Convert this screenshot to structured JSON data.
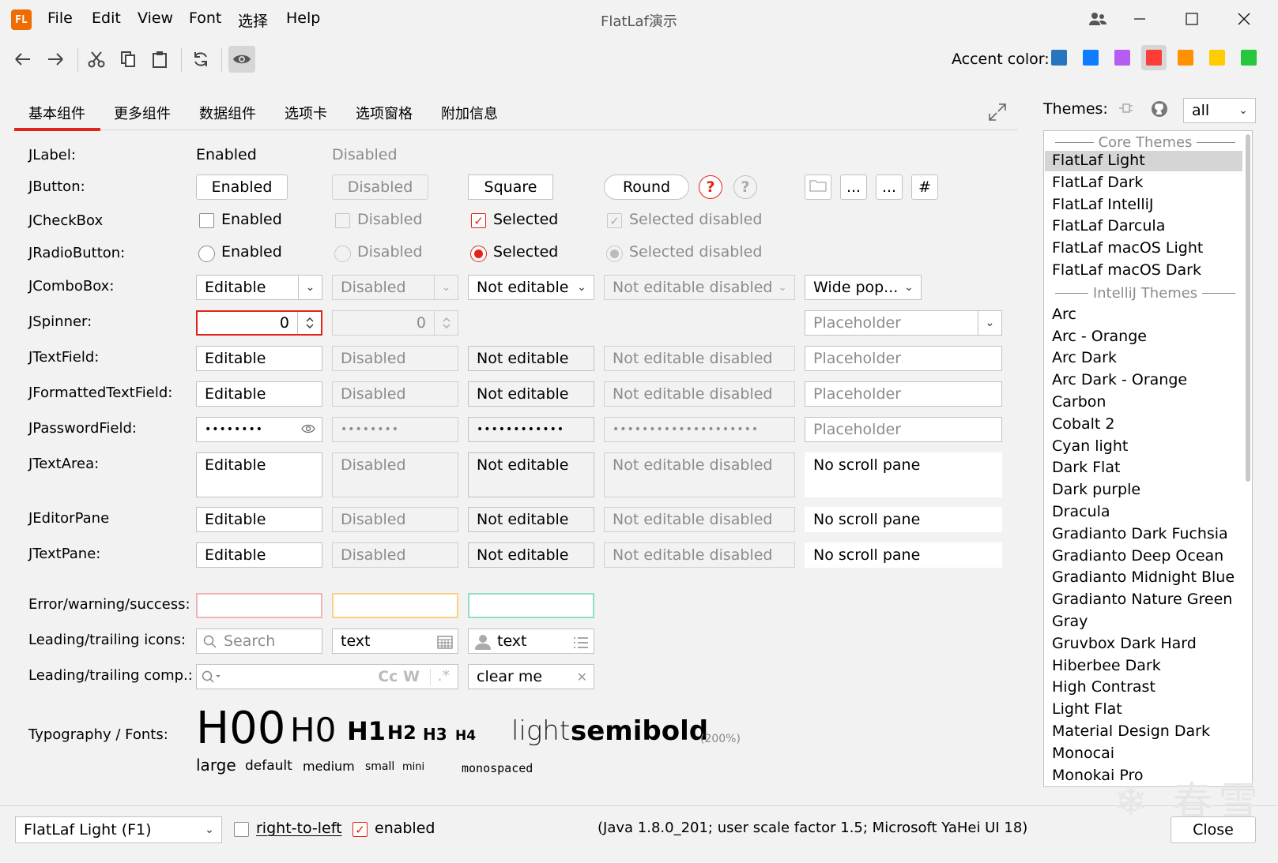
{
  "app": {
    "title": "FlatLaf演示",
    "logo_text": "FL"
  },
  "menus": [
    "File",
    "Edit",
    "View",
    "Font",
    "选择",
    "Help"
  ],
  "accent": {
    "label": "Accent color:",
    "colors": [
      "#2675bf",
      "#0d7cff",
      "#b55df2",
      "#fc3d38",
      "#ff9000",
      "#ffcc00",
      "#25c73c"
    ],
    "selected_index": 3
  },
  "tabs": [
    "基本组件",
    "更多组件",
    "数据组件",
    "选项卡",
    "选项窗格",
    "附加信息"
  ],
  "labels": {
    "jlabel": "JLabel:",
    "jbutton": "JButton:",
    "jcheckbox": "JCheckBox",
    "jradio": "JRadioButton:",
    "jcombo": "JComboBox:",
    "jspinner": "JSpinner:",
    "jtextfield": "JTextField:",
    "jformatted": "JFormattedTextField:",
    "jpassword": "JPasswordField:",
    "jtextarea": "JTextArea:",
    "jeditor": "JEditorPane",
    "jtextpane": "JTextPane:",
    "errors": "Error/warning/success:",
    "icons": "Leading/trailing icons:",
    "comps": "Leading/trailing comp.:",
    "typo": "Typography / Fonts:"
  },
  "values": {
    "enabled": "Enabled",
    "disabled": "Disabled",
    "square": "Square",
    "round": "Round",
    "selected": "Selected",
    "selected_disabled": "Selected disabled",
    "editable": "Editable",
    "not_editable": "Not editable",
    "not_editable_disabled": "Not editable disabled",
    "wide_popup": "Wide pop...",
    "placeholder": "Placeholder",
    "spinner_value": "0",
    "no_scroll": "No scroll pane",
    "search": "Search",
    "text": "text",
    "clear_me": "clear me",
    "dots": "...",
    "hash": "#",
    "help": "?",
    "cc_w": "Cc  W",
    "pw1": "••••••••",
    "pw2": "••••••••",
    "pw3": "••••••••••••",
    "pw4": "••••••••••••••••••••"
  },
  "typography": {
    "h00": "H00",
    "h0": "H0",
    "h1": "H1",
    "h2": "H2",
    "h3": "H3",
    "h4": "H4",
    "light": "light",
    "semibold": "semibold",
    "pct": "(200%)",
    "large": "large",
    "default": "default",
    "medium": "medium",
    "small": "small",
    "mini": "mini",
    "mono": "monospaced"
  },
  "themes": {
    "label": "Themes:",
    "filter": "all",
    "core_header": "Core Themes",
    "core": [
      "FlatLaf Light",
      "FlatLaf Dark",
      "FlatLaf IntelliJ",
      "FlatLaf Darcula",
      "FlatLaf macOS Light",
      "FlatLaf macOS Dark"
    ],
    "intellij_header": "IntelliJ Themes",
    "intellij": [
      "Arc",
      "Arc - Orange",
      "Arc Dark",
      "Arc Dark - Orange",
      "Carbon",
      "Cobalt 2",
      "Cyan light",
      "Dark Flat",
      "Dark purple",
      "Dracula",
      "Gradianto Dark Fuchsia",
      "Gradianto Deep Ocean",
      "Gradianto Midnight Blue",
      "Gradianto Nature Green",
      "Gray",
      "Gruvbox Dark Hard",
      "Hiberbee Dark",
      "High Contrast",
      "Light Flat",
      "Material Design Dark",
      "Monocai",
      "Monokai Pro"
    ],
    "selected": "FlatLaf Light"
  },
  "bottom": {
    "laf": "FlatLaf Light (F1)",
    "rtl": "right-to-left",
    "enabled": "enabled",
    "info": "(Java 1.8.0_201;  user scale factor 1.5; Microsoft YaHei UI 18)",
    "close": "Close"
  },
  "watermark": "❄ 春雪"
}
